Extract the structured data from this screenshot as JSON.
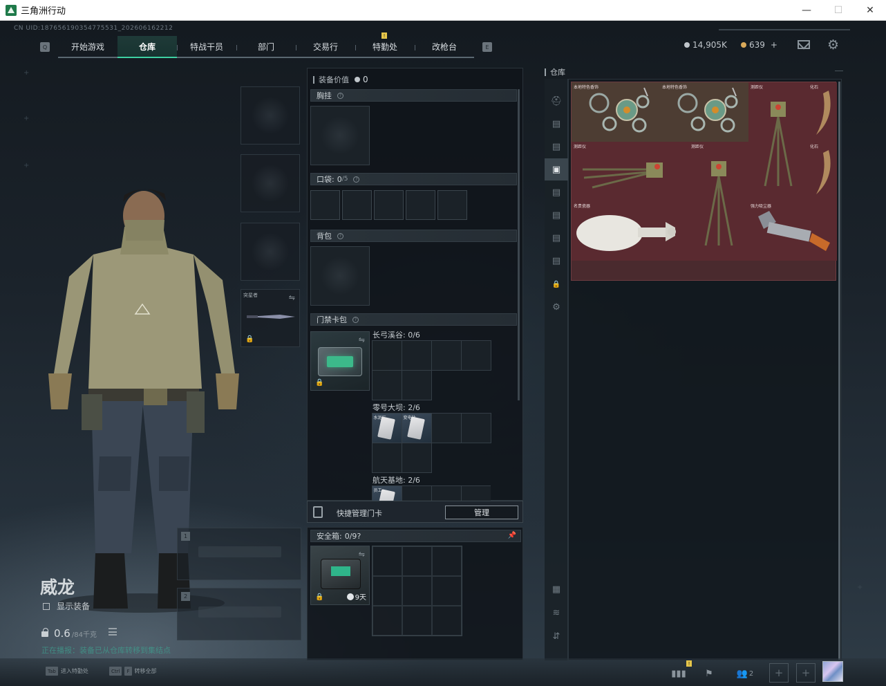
{
  "window": {
    "title": "三角洲行动",
    "min": "—",
    "max": "☐",
    "close": "✕"
  },
  "header": {
    "uid": "CN UID:187656190354775531_202606162212",
    "q_key": "Q",
    "e_key": "E",
    "tabs": [
      {
        "label": "开始游戏",
        "active": false
      },
      {
        "label": "仓库",
        "active": true
      },
      {
        "label": "特战干员",
        "active": false
      },
      {
        "label": "部门",
        "active": false
      },
      {
        "label": "交易行",
        "active": false
      },
      {
        "label": "特勤处",
        "active": false,
        "notification": "!"
      },
      {
        "label": "改枪台",
        "active": false
      }
    ],
    "currency": {
      "silver": "14,905K",
      "gold": "639",
      "add": "+"
    },
    "colors": {
      "accent": "#3ed1a3",
      "silver": "#c0c6cb",
      "gold": "#d9a95a"
    }
  },
  "operator": {
    "name": "威龙",
    "show_gear_label": "显示装备",
    "weight": "0.6",
    "weight_max": "/84千克",
    "ticker": "正在播报：装备已从仓库转移到集结点",
    "melee_label": "突星者",
    "weapon_slot_1": "1",
    "weapon_slot_2": "2"
  },
  "equipment": {
    "value_label": "装备价值",
    "value": "0",
    "chest_rig": {
      "label": "胸挂"
    },
    "pockets": {
      "label": "口袋:",
      "count": "0",
      "capacity": "/5"
    },
    "backpack": {
      "label": "背包"
    },
    "keycard_bag": {
      "label": "门禁卡包",
      "groups": [
        {
          "name": "长弓溪谷: 0/6",
          "cards": []
        },
        {
          "name": "零号大坝: 2/6",
          "cards": [
            "水泥厂",
            "变电站"
          ]
        },
        {
          "name": "航天基地: 2/6",
          "cards": [
            "员工"
          ]
        }
      ]
    },
    "quick_manage_label": "快捷管理门卡",
    "manage_button": "管理",
    "safe": {
      "label": "安全箱:",
      "count": "0",
      "capacity": "/9",
      "timer": "9天"
    }
  },
  "warehouse": {
    "title": "仓库",
    "items": [
      {
        "name": "本地特色香饰",
        "color": "#4a3a32"
      },
      {
        "name": "本地特色香饰",
        "color": "#4a3a32"
      },
      {
        "name": "测距仪",
        "color": "#5a2a30"
      },
      {
        "name": "化石",
        "color": "#5a2a30"
      },
      {
        "name": "测距仪",
        "color": "#5a2a30"
      },
      {
        "name": "测距仪",
        "color": "#5a2a30"
      },
      {
        "name": "化石",
        "color": "#5a2a30"
      },
      {
        "name": "名贵瓷器",
        "color": "#5a2a30"
      },
      {
        "name": "强力吸尘器",
        "color": "#5a2a30"
      }
    ],
    "sidebar_icons": [
      "helmet-icon",
      "category-1-icon",
      "category-2-icon",
      "category-3-icon",
      "category-4-icon",
      "category-5-icon",
      "category-6-icon",
      "category-7-icon",
      "lock-icon",
      "settings-icon",
      "ticket-icon",
      "layers-icon",
      "sort-icon"
    ]
  },
  "footer": {
    "hint1_key": "Tab",
    "hint1_label": "进入特勤处",
    "hint2_key1": "Ctrl",
    "hint2_key2": "F",
    "hint2_label": "转移全部",
    "team_count": "2"
  }
}
